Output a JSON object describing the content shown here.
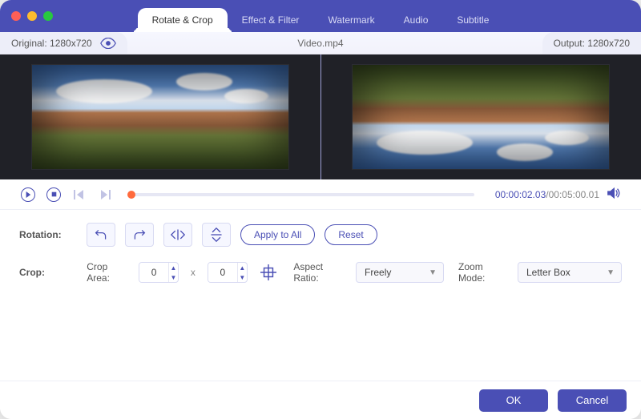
{
  "tabs": {
    "items": [
      {
        "label": "Rotate & Crop"
      },
      {
        "label": "Effect & Filter"
      },
      {
        "label": "Watermark"
      },
      {
        "label": "Audio"
      },
      {
        "label": "Subtitle"
      }
    ],
    "active_index": 0
  },
  "info": {
    "original_label": "Original: 1280x720",
    "filename": "Video.mp4",
    "output_label": "Output: 1280x720"
  },
  "playback": {
    "current_time": "00:00:02.03",
    "time_separator": "/",
    "total_time": "00:05:00.01",
    "progress_percent": 1.0
  },
  "rotation": {
    "label": "Rotation:",
    "apply_all_label": "Apply to All",
    "reset_label": "Reset"
  },
  "crop": {
    "label": "Crop:",
    "area_label": "Crop Area:",
    "width": "0",
    "height": "0",
    "times": "x",
    "aspect_label": "Aspect Ratio:",
    "aspect_value": "Freely",
    "zoom_label": "Zoom Mode:",
    "zoom_value": "Letter Box"
  },
  "footer": {
    "ok": "OK",
    "cancel": "Cancel"
  },
  "colors": {
    "accent": "#4a4fb5",
    "slider": "#ff6a3d"
  }
}
